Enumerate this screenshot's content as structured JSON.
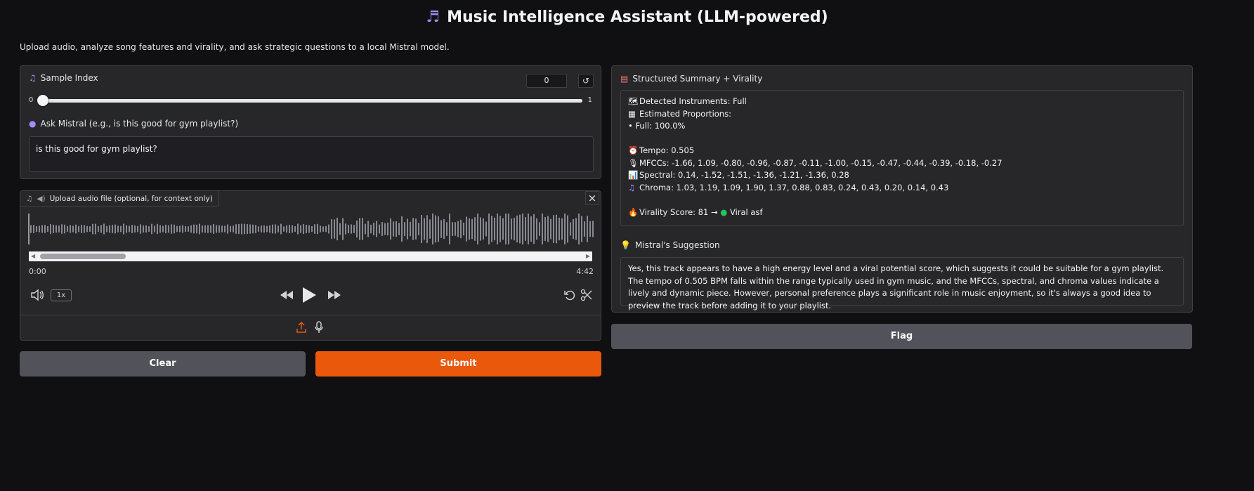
{
  "header": {
    "title": "Music Intelligence Assistant (LLM-powered)",
    "subtitle": "Upload audio, analyze song features and virality, and ask strategic questions to a local Mistral model."
  },
  "sample_index": {
    "label": "Sample Index",
    "value": "0",
    "min": "0",
    "max": "1",
    "slider_fraction": 0
  },
  "ask": {
    "label": "Ask Mistral (e.g., is this good for gym playlist?)",
    "value": "is this good for gym playlist?"
  },
  "audio": {
    "label": "Upload audio file (optional, for context only)",
    "current_time": "0:00",
    "duration": "4:42",
    "speed": "1x"
  },
  "buttons": {
    "clear": "Clear",
    "submit": "Submit",
    "flag": "Flag"
  },
  "summary": {
    "label": "Structured Summary + Virality",
    "instruments": "Detected Instruments: Full",
    "proportions_label": "Estimated Proportions:",
    "proportion_item": "• Full: 100.0%",
    "tempo": "Tempo: 0.505",
    "mfccs": "MFCCs: -1.66, 1.09, -0.80, -0.96, -0.87, -0.11, -1.00, -0.15, -0.47, -0.44, -0.39, -0.18, -0.27",
    "spectral": "Spectral: 0.14, -1.52, -1.51, -1.36, -1.21, -1.36, 0.28",
    "chroma": "Chroma: 1.03, 1.19, 1.09, 1.90, 1.37, 0.88, 0.83, 0.24, 0.43, 0.20, 0.14, 0.43",
    "virality_prefix": "Virality Score: 81 →",
    "virality_suffix": "Viral asf"
  },
  "suggestion": {
    "label": "Mistral's Suggestion",
    "text": "Yes, this track appears to have a high energy level and a viral potential score, which suggests it could be suitable for a gym playlist. The tempo of 0.505 BPM falls within the range typically used in gym music, and the MFCCs, spectral, and chroma values indicate a lively and dynamic piece. However, personal preference plays a significant role in music enjoyment, so it's always a good idea to preview the track before adding it to your playlist."
  },
  "colors": {
    "accent": "#ea580c",
    "secondary_button": "#52525b",
    "background": "#101013",
    "panel": "#27272a"
  },
  "icons": [
    "music-notes-icon",
    "note-icon",
    "moon-icon",
    "speaker-icon",
    "close-icon",
    "volume-icon",
    "rewind-icon",
    "play-icon",
    "fast-forward-icon",
    "undo-icon",
    "scissors-icon",
    "upload-icon",
    "microphone-icon",
    "clipboard-icon",
    "bulb-icon",
    "fire-icon",
    "green-circle-icon"
  ]
}
